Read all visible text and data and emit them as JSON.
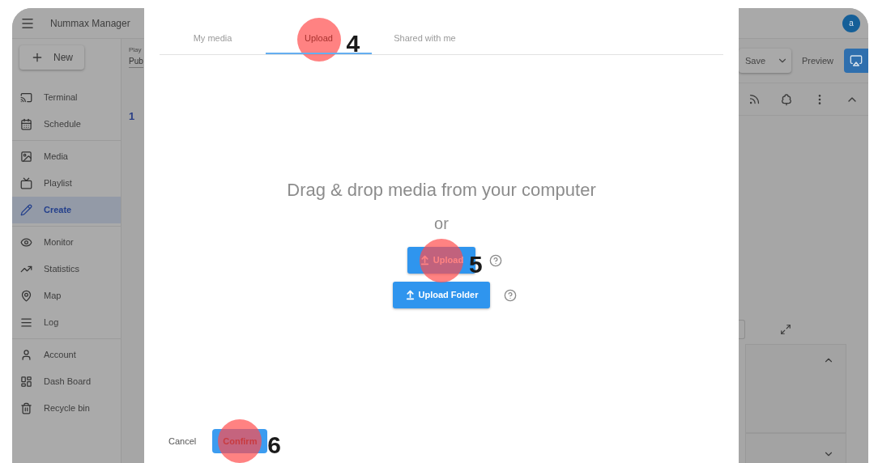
{
  "app": {
    "title": "Nummax Manager",
    "avatar": "a",
    "new_button": "New"
  },
  "sidebar": {
    "groups": [
      [
        {
          "label": "Terminal",
          "selected": false
        },
        {
          "label": "Schedule",
          "selected": false
        }
      ],
      [
        {
          "label": "Media",
          "selected": false
        },
        {
          "label": "Playlist",
          "selected": false
        },
        {
          "label": "Create",
          "selected": true
        }
      ],
      [
        {
          "label": "Monitor",
          "selected": false
        },
        {
          "label": "Statistics",
          "selected": false
        },
        {
          "label": "Map",
          "selected": false
        },
        {
          "label": "Log",
          "selected": false
        }
      ],
      [
        {
          "label": "Account",
          "selected": false
        },
        {
          "label": "Dash Board",
          "selected": false
        },
        {
          "label": "Recycle bin",
          "selected": false
        }
      ]
    ]
  },
  "editor": {
    "field_label": "Play",
    "field_value": "Pub",
    "step": "1",
    "save_button": "Save",
    "preview_button": "Preview"
  },
  "dialog": {
    "tabs": [
      {
        "label": "My media",
        "selected": false
      },
      {
        "label": "Upload",
        "selected": true,
        "callout": "4"
      },
      {
        "label": "Shared with me",
        "selected": false
      }
    ],
    "drop_text": "Drag & drop media from your computer",
    "or_text": "or",
    "upload_buttons": [
      {
        "label": "Upload",
        "callout": "5"
      },
      {
        "label": "Upload Folder"
      }
    ],
    "cancel_button": "Cancel",
    "confirm_button": {
      "label": "Confirm",
      "callout": "6"
    }
  }
}
